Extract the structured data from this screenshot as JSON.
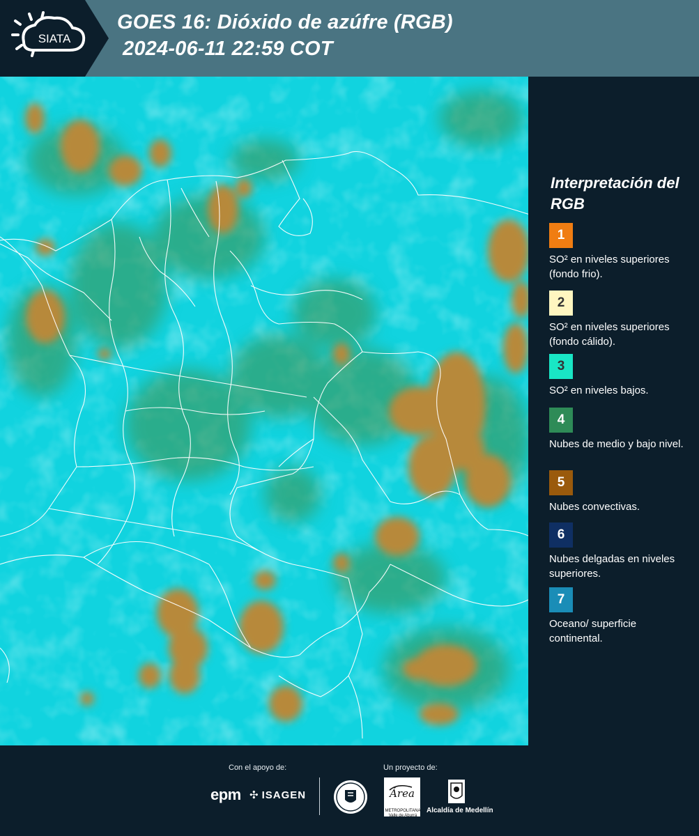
{
  "header": {
    "logo_text": "SIATA",
    "title": "GOES 16: Dióxido de azúfre (RGB)",
    "timestamp": "2024-06-11 22:59 COT"
  },
  "legend": {
    "title": "Interpretación del RGB",
    "items": [
      {
        "number": "1",
        "color": "#f07d12",
        "text": "SO² en niveles superiores (fondo frio)."
      },
      {
        "number": "2",
        "color": "#fff6c0",
        "text": "SO² en niveles superiores (fondo cálido)."
      },
      {
        "number": "3",
        "color": "#19e6c5",
        "text": "SO² en niveles bajos."
      },
      {
        "number": "4",
        "color": "#2e8b57",
        "text": "Nubes de medio y bajo nivel."
      },
      {
        "number": "5",
        "color": "#9a5a0c",
        "text": "Nubes convectivas."
      },
      {
        "number": "6",
        "color": "#0f2f63",
        "text": "Nubes delgadas en niveles superiores."
      },
      {
        "number": "7",
        "color": "#1a8db7",
        "text": "Oceano/ superficie continental."
      }
    ]
  },
  "map": {
    "background_color": "#11d3df",
    "convective_cloud_color": "#b7893a",
    "mid_low_cloud_color": "#3f8f4a",
    "boundary_color": "#ffffff"
  },
  "footer": {
    "support_caption": "Con el apoyo de:",
    "project_caption": "Un proyecto de:",
    "sponsors": [
      "epm",
      "ISAGEN"
    ],
    "partner_label": "Alcaldía de Medellín",
    "area_label": "METROPOLITANA Valle de Aburrá",
    "area_logo_text": "Área"
  }
}
